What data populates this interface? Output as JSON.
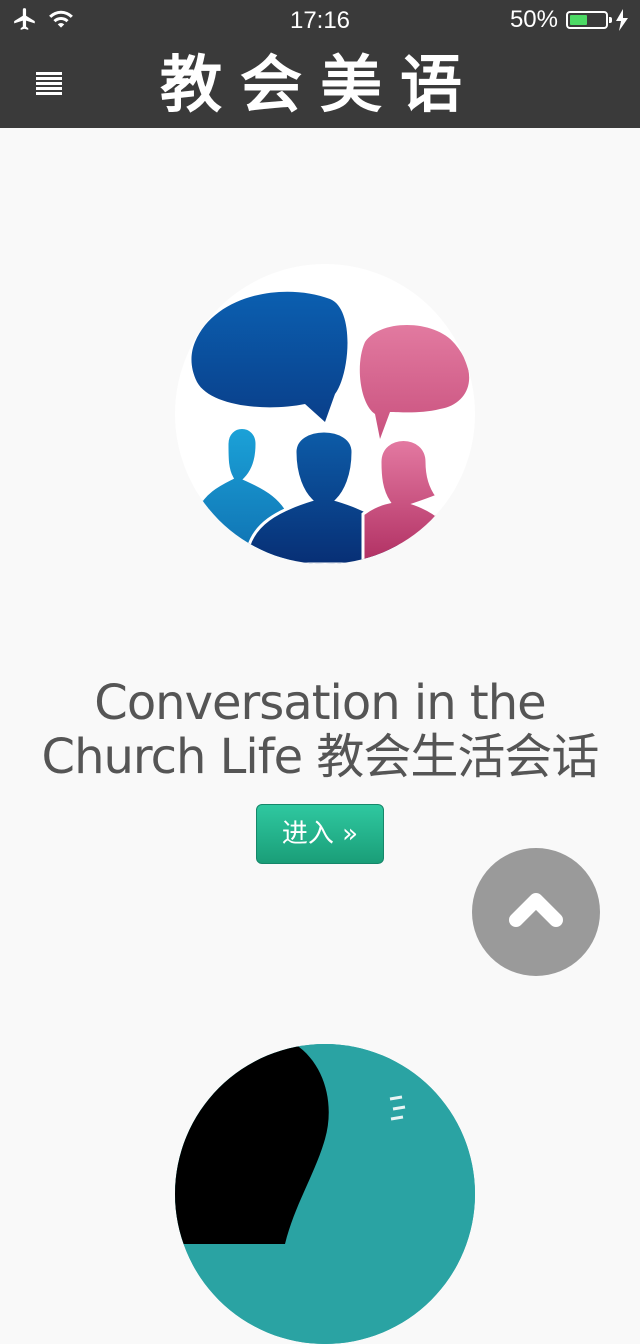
{
  "status_bar": {
    "time": "17:16",
    "battery_percent": "50%",
    "battery_level": 0.5,
    "icons": [
      "airplane-icon",
      "wifi-icon",
      "battery-icon",
      "charging-icon"
    ]
  },
  "header": {
    "title": "教会美语",
    "menu_icon": "hamburger-icon"
  },
  "cards": [
    {
      "title": "Conversation in the Church Life 教会生活会话",
      "button_label": "进入 »",
      "image_icon": "people-speech-bubbles-icon"
    }
  ],
  "back_to_top": {
    "icon": "chevron-up-icon"
  },
  "colors": {
    "header_bg": "#3a3a3a",
    "button_green": "#1fae86",
    "back_to_top_gray": "#9a9a9a",
    "page_bg": "#f9f9f9"
  }
}
